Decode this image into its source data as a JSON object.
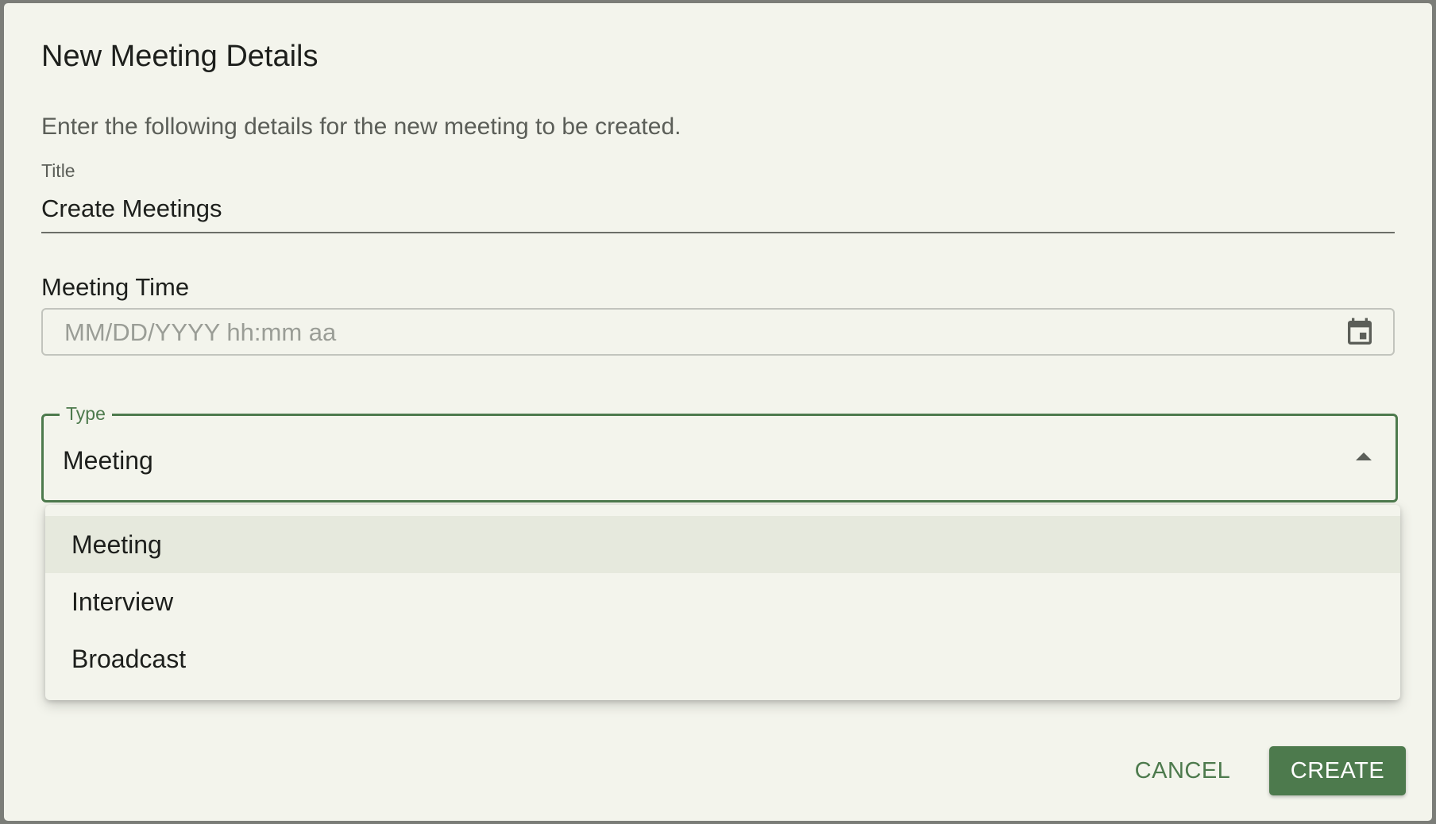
{
  "dialog": {
    "title": "New Meeting Details",
    "description": "Enter the following details for the new meeting to be created."
  },
  "fields": {
    "title": {
      "label": "Title",
      "value": "Create Meetings"
    },
    "meeting_time": {
      "label": "Meeting Time",
      "placeholder": "MM/DD/YYYY hh:mm aa",
      "icon": "calendar-icon"
    },
    "type": {
      "label": "Type",
      "value": "Meeting",
      "icon": "caret-up-icon",
      "options": [
        "Meeting",
        "Interview",
        "Broadcast"
      ],
      "selected_index": 0
    }
  },
  "actions": {
    "cancel_label": "CANCEL",
    "create_label": "CREATE"
  },
  "colors": {
    "accent": "#4d7a4d",
    "background": "#f3f4ec",
    "selected_option": "#e6e9dd"
  }
}
